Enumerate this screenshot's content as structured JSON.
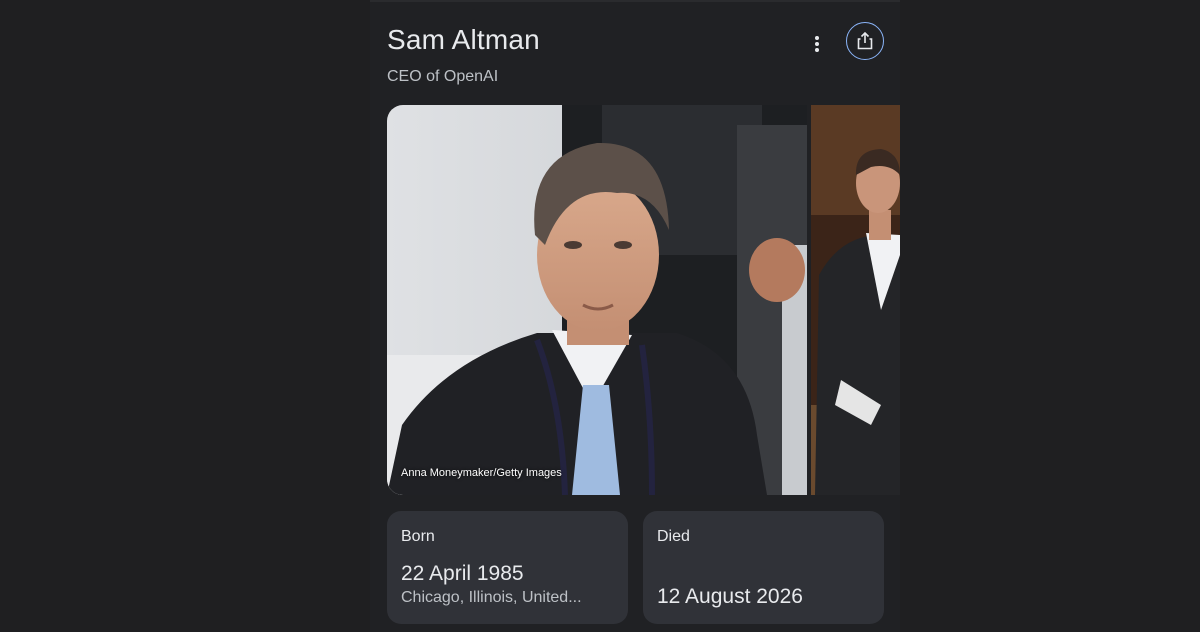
{
  "knowledge_panel": {
    "title": "Sam Altman",
    "subtitle": "CEO of OpenAI",
    "more_icon": "more-vert-icon",
    "share_icon": "share-icon",
    "accent_color": "#8ab4f8"
  },
  "images": {
    "main_credit": "Anna Moneymaker/Getty Images"
  },
  "facts": {
    "born": {
      "label": "Born",
      "value": "22 April 1985",
      "place": "Chicago, Illinois, United..."
    },
    "died": {
      "label": "Died",
      "value": "12 August 2026"
    }
  }
}
